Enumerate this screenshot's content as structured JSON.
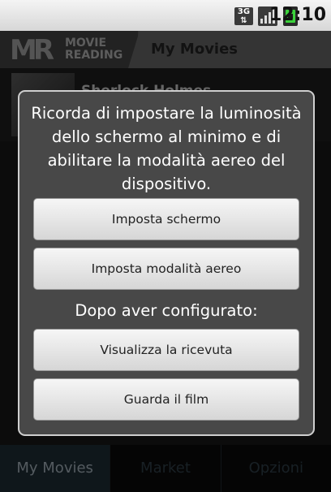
{
  "status_bar": {
    "network": "3G",
    "time": "12:10",
    "icons": [
      "3g-icon",
      "signal-icon",
      "battery-icon"
    ]
  },
  "header": {
    "logo_line1": "MOVIE",
    "logo_line2": "READING",
    "title": "My Movies"
  },
  "background_list": {
    "item_title": "Sherlock Holmes"
  },
  "dialog": {
    "message": "Ricorda di impostare la luminosità dello schermo al minimo e di abilitare la modalità aereo del dispositivo.",
    "button_screen": "Imposta schermo",
    "button_airplane": "Imposta modalità aereo",
    "after_config": "Dopo aver configurato:",
    "button_receipt": "Visualizza la ricevuta",
    "button_watch": "Guarda il film"
  },
  "tabs": [
    {
      "label": "My Movies"
    },
    {
      "label": "Market"
    },
    {
      "label": "Opzioni"
    }
  ],
  "colors": {
    "accent_active_tab": "#1c2a32",
    "battery": "#3bd23b"
  }
}
